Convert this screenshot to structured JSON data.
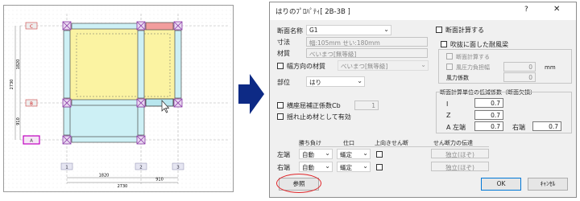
{
  "plan": {
    "row_labels": {
      "c": "C",
      "b": "B",
      "a": "A"
    },
    "left_dims": {
      "top": "1820",
      "mid": "910",
      "total": "2730"
    },
    "col_labels": {
      "c1": "1",
      "c2": "2",
      "c3": "3"
    },
    "bottom_dims": {
      "span1": "1820",
      "span2": "910",
      "total": "2730"
    }
  },
  "dialog": {
    "title": "はりのﾌﾟﾛﾊﾟﾃｨ[ 2B-3B ]",
    "help": "?",
    "close": "✕",
    "section_name_label": "断面名称",
    "section_name_value": "G1",
    "size_label": "寸法",
    "size_value": "幅:105mm  せい:180mm",
    "material_label": "材質",
    "material_value": "べいまつ[無等級]",
    "width_material_label": "幅方向の材質",
    "width_material_value": "べいまつ[無等級]",
    "part_label": "部位",
    "part_value": "はり",
    "lateral_buckling_label": "横座屈補正係数Cb",
    "lateral_buckling_value": "1",
    "twist_label": "揺れ止め材として有効",
    "calc_section_label": "断面計算する",
    "wind_beam_label": "吹抜に面した耐風梁",
    "wind_calc_label": "断面計算する",
    "wind_width_label": "風圧力負担幅",
    "wind_width_value": "0",
    "wind_width_unit": "mm",
    "wind_coef_label": "風力係数",
    "wind_coef_value": "0",
    "reduction": {
      "title": "断面計算単位の低減係数（断面欠損）",
      "i_label": "I",
      "i_value": "0.7",
      "z_label": "Z",
      "z_value": "0.7",
      "a_left_label": "A 左端",
      "a_left_value": "0.7",
      "right_label": "右端",
      "right_value": "0.7"
    },
    "end_table": {
      "headers": {
        "win": "勝ち負け",
        "joint": "仕口",
        "upward": "上向きせん断",
        "shear": "せん断力の伝達"
      },
      "left": {
        "label": "左端",
        "win": "自動",
        "joint": "蟻定",
        "shear": "独立(ほぞ)"
      },
      "right": {
        "label": "右端",
        "win": "自動",
        "joint": "蟻定",
        "shear": "独立(ほぞ)"
      }
    },
    "ref_button": "参照",
    "ok_button": "OK",
    "cancel_button": "ｷｬﾝｾﾙ"
  },
  "colors": {
    "yellow": "#fbf3a2",
    "cyan": "#cdf0f5",
    "pink": "#f29d9d",
    "magenta": "#c000c0",
    "arrow": "#0d2a85",
    "red_circle": "#e0262a"
  }
}
